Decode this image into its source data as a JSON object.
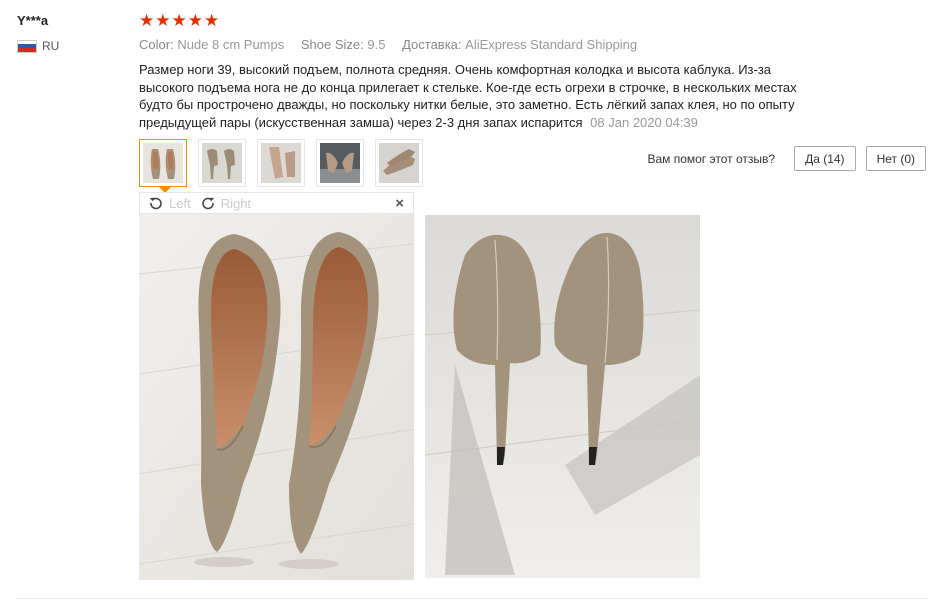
{
  "review": {
    "user_name": "Y***a",
    "country_code": "RU",
    "rating": "★★★★★",
    "rating_value": 5,
    "attributes": [
      {
        "key": "Color:",
        "value": "Nude 8 cm Pumps"
      },
      {
        "key": "Shoe Size:",
        "value": "9.5"
      },
      {
        "key": "Доставка:",
        "value": "AliExpress Standard Shipping"
      }
    ],
    "text": "Размер ноги 39, высокий подъем, полнота средняя. Очень комфортная колодка и высота каблука. Из-за высокого подъема нога не до конца прилегает к стельке. Кое-где есть огрехи в строчке, в нескольких местах будто бы прострочено дважды, но поскольку нитки белые, это заметно. Есть лёгкий запах клея, но по опыту предыдущей пары (искусственная замша) через 2-3 дня запах испарится",
    "date": "08 Jan 2020 04:39"
  },
  "helpful": {
    "question": "Вам помог этот отзыв?",
    "yes_label": "Да (14)",
    "no_label": "Нет (0)"
  },
  "viewer": {
    "rotate_left_label": "Left",
    "rotate_right_label": "Right",
    "close_label": "×"
  },
  "colors": {
    "star": "#e62e04",
    "active_thumb_border": "#f08f00",
    "shoe_nude": "#a3937c",
    "shoe_insole": "#b77a55"
  },
  "icons": {
    "rotate_left": "rotate-left-icon",
    "rotate_right": "rotate-right-icon",
    "close": "close-icon",
    "flag": "russia-flag-icon"
  }
}
